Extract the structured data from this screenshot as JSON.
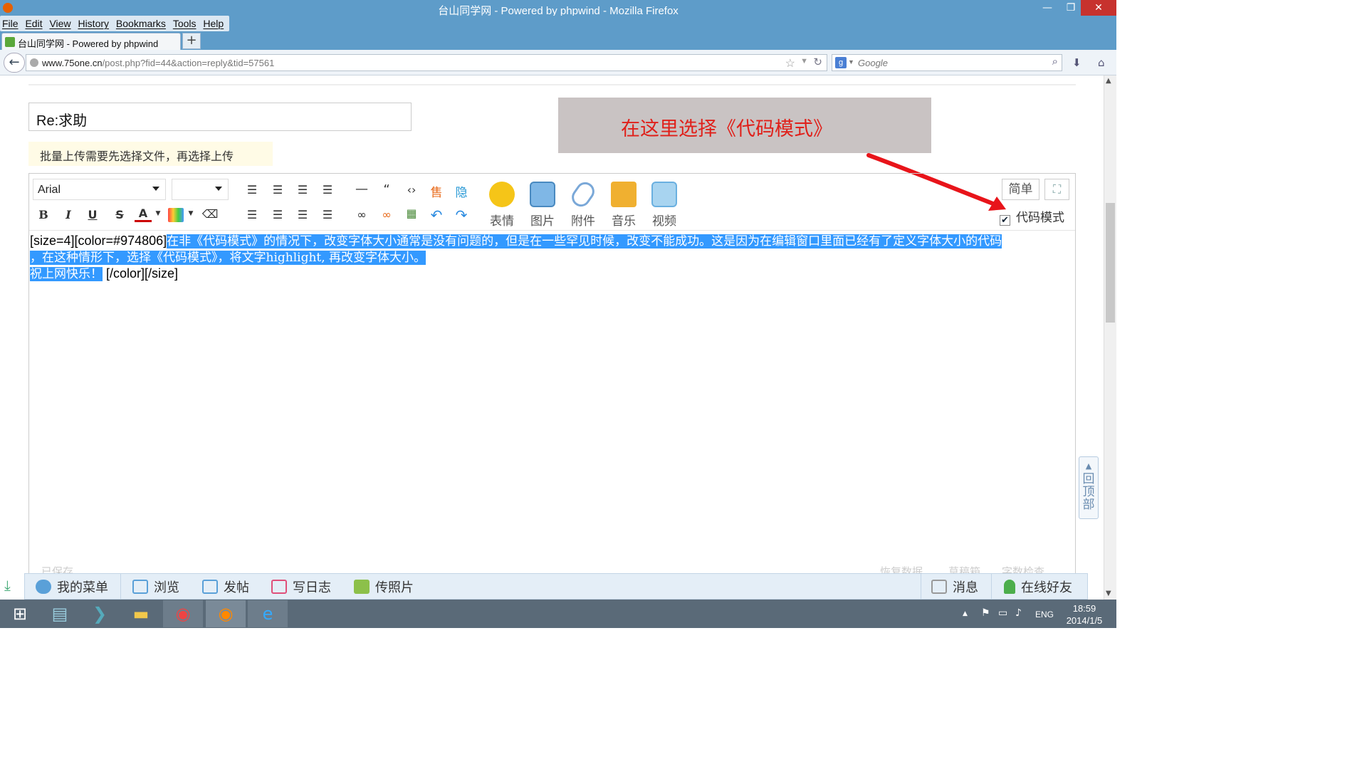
{
  "window": {
    "title": "台山同学网 - Powered by phpwind - Mozilla Firefox",
    "minimize": "—",
    "restore": "❐",
    "close": "✕"
  },
  "menu": [
    "File",
    "Edit",
    "View",
    "History",
    "Bookmarks",
    "Tools",
    "Help"
  ],
  "tab": {
    "title": "台山同学网 - Powered by phpwind",
    "new_tab": "+"
  },
  "url": {
    "host": "www.75one.cn",
    "path": "/post.php?fid=44&action=reply&tid=57561"
  },
  "search": {
    "placeholder": "Google"
  },
  "post": {
    "subject": "Re:求助",
    "notice": "批量上传需要先选择文件，再选择上传",
    "callout": "在这里选择《代码模式》"
  },
  "editor": {
    "font": "Arial",
    "size": "",
    "media": [
      {
        "label": "表情",
        "icon": "smiley-icon",
        "color": "#f5c518"
      },
      {
        "label": "图片",
        "icon": "image-icon",
        "color": "#7fb7e6"
      },
      {
        "label": "附件",
        "icon": "attachment-icon",
        "color": "#ffffff"
      },
      {
        "label": "音乐",
        "icon": "music-icon",
        "color": "#f0b030"
      },
      {
        "label": "视频",
        "icon": "video-icon",
        "color": "#a8d4f0"
      }
    ],
    "simple_button": "简单",
    "code_mode_label": "代码模式",
    "code_mode_checked": true,
    "content": {
      "prefix": "[size=4][color=#974806]",
      "line1_sel": "在非《代码模式》的情况下，改变字体大小通常是没有问题的，但是在一些罕见时候，改变不能成功。这是因为在编辑窗口里面已经有了定义字体大小的代码",
      "line2_sel": "，在这种情形下，选择《代码模式》，将文字highlight, 再改变字体大小。",
      "line3_sel": "祝上网快乐！",
      "suffix": "[/color][/size]"
    },
    "footer_left": "已保存",
    "footer_right": [
      "恢复数据",
      "草稿箱",
      "字数检查"
    ]
  },
  "back_to_top": "回顶部",
  "bottom_bar": {
    "items": [
      "我的菜单",
      "浏览",
      "发帖",
      "写日志",
      "传照片"
    ],
    "right": [
      "消息",
      "在线好友"
    ]
  },
  "taskbar": {
    "apps": [
      "windows-start-icon",
      "explorer-icon",
      "powershell-icon",
      "folder-icon",
      "chrome-icon",
      "firefox-icon",
      "ie-icon"
    ],
    "lang": "ENG",
    "time": "18:59",
    "date": "2014/1/5"
  }
}
